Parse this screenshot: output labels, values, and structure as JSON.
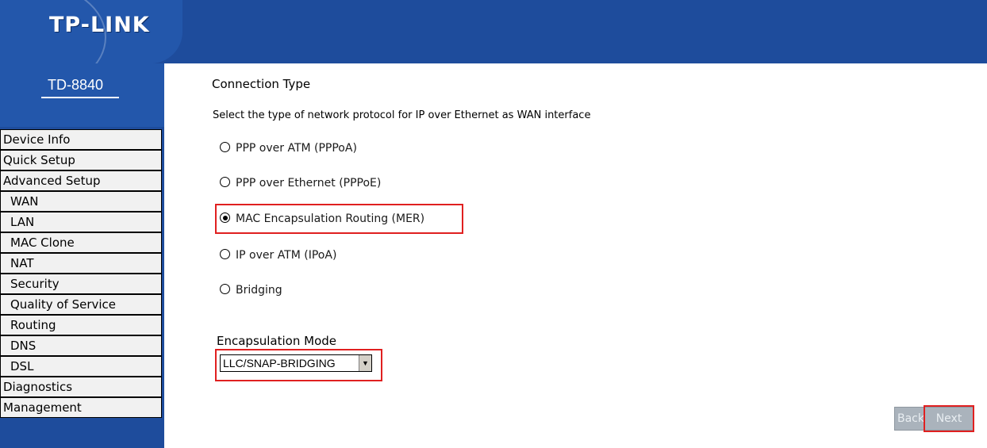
{
  "header": {
    "brand": "TP-LINK"
  },
  "sidebar": {
    "model": "TD-8840",
    "items": [
      {
        "label": "Device Info",
        "sub": false
      },
      {
        "label": "Quick Setup",
        "sub": false
      },
      {
        "label": "Advanced Setup",
        "sub": false
      },
      {
        "label": "WAN",
        "sub": true
      },
      {
        "label": "LAN",
        "sub": true
      },
      {
        "label": "MAC Clone",
        "sub": true
      },
      {
        "label": "NAT",
        "sub": true
      },
      {
        "label": "Security",
        "sub": true
      },
      {
        "label": "Quality of Service",
        "sub": true
      },
      {
        "label": "Routing",
        "sub": true
      },
      {
        "label": "DNS",
        "sub": true
      },
      {
        "label": "DSL",
        "sub": true
      },
      {
        "label": "Diagnostics",
        "sub": false
      },
      {
        "label": "Management",
        "sub": false
      }
    ]
  },
  "main": {
    "title": "Connection Type",
    "description": "Select the type of network protocol for IP over Ethernet as WAN interface",
    "options": [
      {
        "label": "PPP over ATM (PPPoA)",
        "checked": false
      },
      {
        "label": "PPP over Ethernet (PPPoE)",
        "checked": false
      },
      {
        "label": "MAC Encapsulation Routing (MER)",
        "checked": true
      },
      {
        "label": "IP over ATM (IPoA)",
        "checked": false
      },
      {
        "label": "Bridging",
        "checked": false
      }
    ],
    "encapsulation": {
      "label": "Encapsulation Mode",
      "selected": "LLC/SNAP-BRIDGING"
    },
    "buttons": {
      "back": "Back",
      "next": "Next"
    }
  },
  "colors": {
    "header_blue": "#1e4c9c",
    "highlight_red": "#e02020",
    "button_gray": "#aab3bc"
  }
}
